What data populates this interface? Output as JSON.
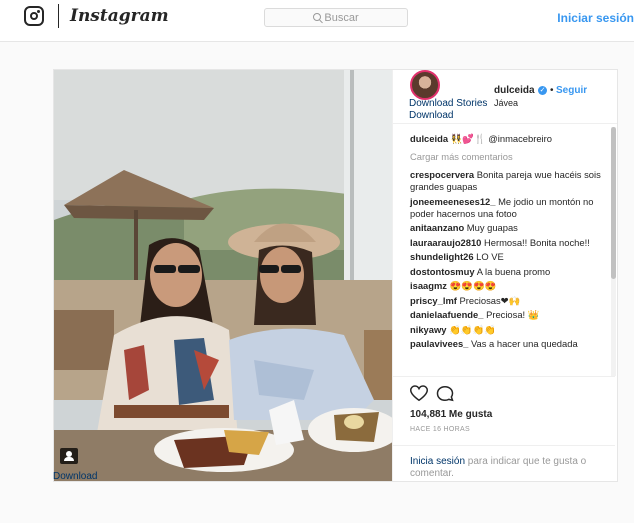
{
  "topbar": {
    "logo_text": "Instagram",
    "search_placeholder": "Buscar",
    "login_label": "Iniciar sesión"
  },
  "post": {
    "username": "dulceida",
    "follow_label": "Seguir",
    "location": "Jávea",
    "download_stories": "Download Stories",
    "download_label": "Download",
    "photo_download": "Download",
    "load_more": "Cargar más comentarios",
    "comments": [
      {
        "user": "dulceida",
        "text": "👯‍♀️💕🍴 @inmacebreiro"
      },
      {
        "user": "crespocervera",
        "text": "Bonita pareja wue hacéis sois grandes guapas"
      },
      {
        "user": "joneemeeneses12_",
        "text": "Me jodio un montón no poder hacernos una fotoo"
      },
      {
        "user": "anitaanzano",
        "text": "Muy guapas"
      },
      {
        "user": "lauraaraujo2810",
        "text": "Hermosa!! Bonita noche!!"
      },
      {
        "user": "shundelight26",
        "text": "LO VE"
      },
      {
        "user": "dostontosmuy",
        "text": "A la buena promo"
      },
      {
        "user": "isaagmz",
        "text": "😍😍😍😍"
      },
      {
        "user": "priscy_lmf",
        "text": "Preciosas❤🙌"
      },
      {
        "user": "danielaafuende_",
        "text": "Preciosa! 👑"
      },
      {
        "user": "nikyawy",
        "text": "👏👏👏👏"
      },
      {
        "user": "paulavivees_",
        "text": "Vas a hacer una quedada"
      }
    ],
    "likes": "104,881 Me gusta",
    "time": "HACE 16 HORAS",
    "login_prompt_link": "Inicia sesión",
    "login_prompt_rest": " para indicar que te gusta o comentar."
  },
  "colors": {
    "accent": "#3897f0",
    "link": "#003569",
    "muted": "#999999"
  }
}
